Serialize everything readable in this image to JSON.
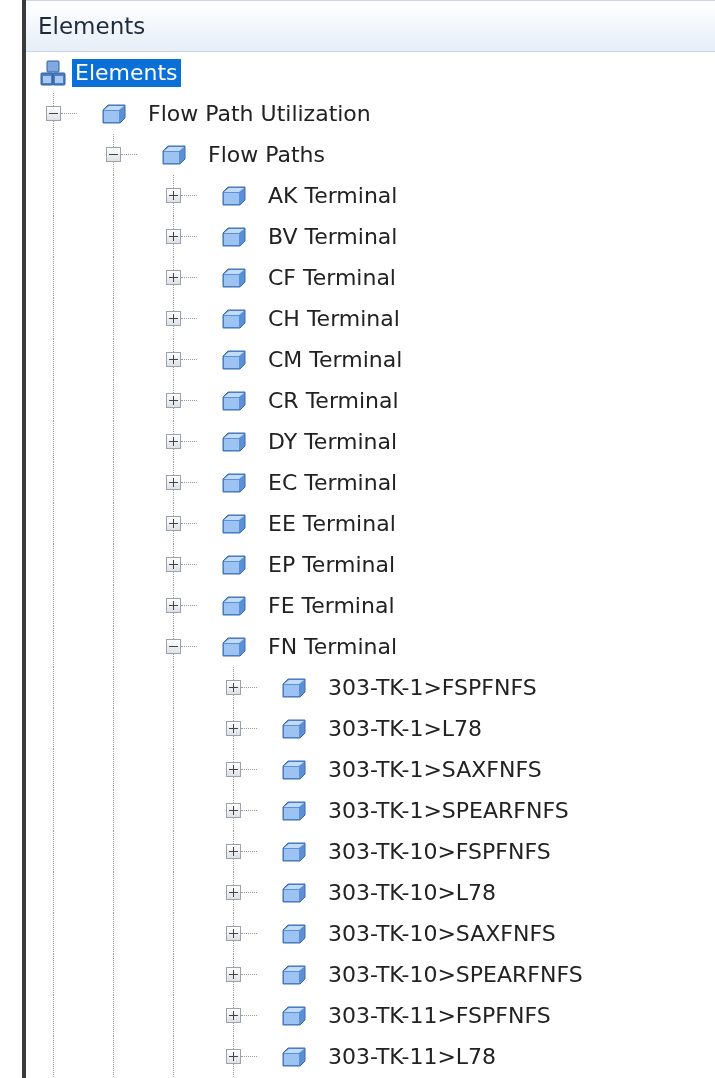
{
  "panel": {
    "title": "Elements"
  },
  "tree": {
    "label": "Elements",
    "selected": true,
    "children": [
      {
        "label": "Flow Path Utilization",
        "expanded": true,
        "selected": false,
        "children": [
          {
            "label": "Flow Paths",
            "expanded": true,
            "selected": false,
            "children": [
              {
                "label": "AK Terminal",
                "expanded": false,
                "selected": false
              },
              {
                "label": "BV Terminal",
                "expanded": false,
                "selected": false
              },
              {
                "label": "CF Terminal",
                "expanded": false,
                "selected": false
              },
              {
                "label": "CH Terminal",
                "expanded": false,
                "selected": false
              },
              {
                "label": "CM Terminal",
                "expanded": false,
                "selected": false
              },
              {
                "label": "CR Terminal",
                "expanded": false,
                "selected": false
              },
              {
                "label": "DY Terminal",
                "expanded": false,
                "selected": false
              },
              {
                "label": "EC Terminal",
                "expanded": false,
                "selected": false
              },
              {
                "label": "EE Terminal",
                "expanded": false,
                "selected": false
              },
              {
                "label": "EP Terminal",
                "expanded": false,
                "selected": false
              },
              {
                "label": "FE Terminal",
                "expanded": false,
                "selected": false
              },
              {
                "label": "FN Terminal",
                "expanded": true,
                "selected": false,
                "children": [
                  {
                    "label": "303-TK-1>FSPFNFS",
                    "expanded": false,
                    "selected": false
                  },
                  {
                    "label": "303-TK-1>L78",
                    "expanded": false,
                    "selected": false
                  },
                  {
                    "label": "303-TK-1>SAXFNFS",
                    "expanded": false,
                    "selected": false
                  },
                  {
                    "label": "303-TK-1>SPEARFNFS",
                    "expanded": false,
                    "selected": false
                  },
                  {
                    "label": "303-TK-10>FSPFNFS",
                    "expanded": false,
                    "selected": false
                  },
                  {
                    "label": "303-TK-10>L78",
                    "expanded": false,
                    "selected": false
                  },
                  {
                    "label": "303-TK-10>SAXFNFS",
                    "expanded": false,
                    "selected": false
                  },
                  {
                    "label": "303-TK-10>SPEARFNFS",
                    "expanded": false,
                    "selected": false
                  },
                  {
                    "label": "303-TK-11>FSPFNFS",
                    "expanded": false,
                    "selected": false
                  },
                  {
                    "label": "303-TK-11>L78",
                    "expanded": false,
                    "selected": false
                  }
                ]
              }
            ]
          }
        ]
      }
    ]
  }
}
